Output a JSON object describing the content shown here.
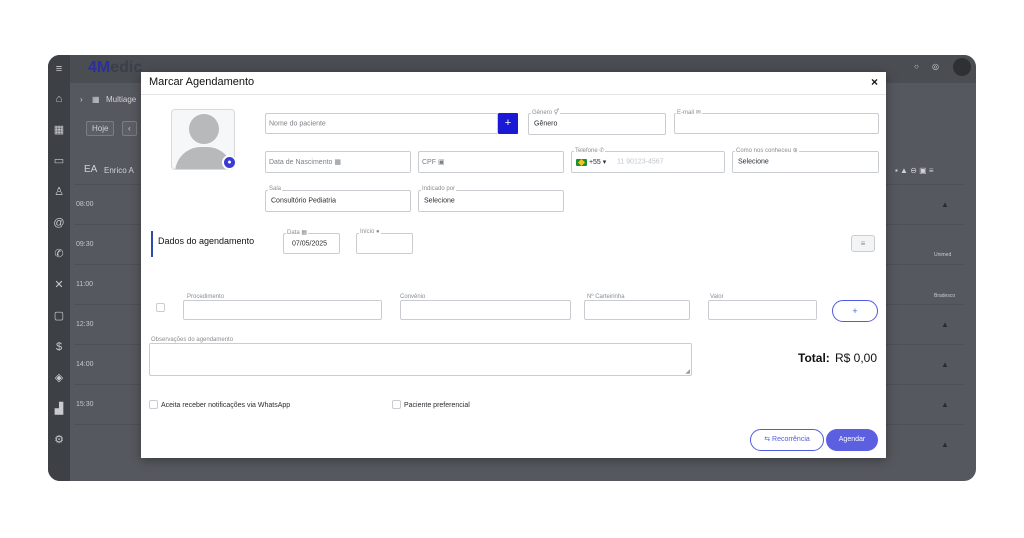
{
  "app": {
    "brand_prefix": "4M",
    "brand_suffix": "edic",
    "breadcrumb": "Multiage",
    "today_button": "Hoje",
    "prev_icon": "‹",
    "patient_initials": "EA",
    "patient_name_partial": "Enrico A",
    "times": [
      "08:00",
      "09:30",
      "11:00",
      "12:30",
      "14:00",
      "15:30"
    ],
    "row_notes": [
      "Unimed",
      "Bradesco"
    ],
    "colors": {
      "brand": "#2b2f9e",
      "accent": "#4f5be0",
      "primary_button": "#1a1ad6"
    }
  },
  "modal": {
    "title": "Marcar Agendamento",
    "close": "×",
    "patient_name": {
      "placeholder": "Nome do paciente",
      "add": "+"
    },
    "genero": {
      "label": "Gênero",
      "icon": "⚥",
      "value": "Gênero"
    },
    "email": {
      "label": "E-mail",
      "icon": "✉"
    },
    "birth": {
      "placeholder": "Data de Nascimento",
      "icon": "▦"
    },
    "cpf": {
      "placeholder": "CPF",
      "icon": "▣"
    },
    "telefone": {
      "label": "Telefone",
      "icon": "✆",
      "country_code": "+55",
      "caret": "▾",
      "placeholder": "11 90123-4567"
    },
    "conheceu": {
      "label": "Como nos conheceu",
      "icon": "⊕",
      "value": "Selecione"
    },
    "sala": {
      "label": "Sala",
      "value": "Consultório Pediatria"
    },
    "indicado": {
      "label": "Indicado por",
      "value": "Selecione"
    },
    "section_title": "Dados do agendamento",
    "data": {
      "label": "Data",
      "icon": "▦",
      "value": "07/05/2025"
    },
    "inicio": {
      "label": "Início",
      "icon": "●"
    },
    "list_icon": "≡",
    "procedimento": {
      "label": "Procedimento"
    },
    "convenio": {
      "label": "Convênio"
    },
    "carteirinha": {
      "label": "Nº Carteirinha"
    },
    "valor": {
      "label": "Valor"
    },
    "add_item": "+",
    "observacoes": {
      "label": "Observações do agendamento"
    },
    "total_label": "Total:",
    "total_value": "R$ 0,00",
    "whatsapp": "Aceita receber notificações via WhatsApp",
    "preferencial": "Paciente preferencial",
    "recorrencia_icon": "⇆",
    "recorrencia": "Recorrência",
    "agendar": "Agendar"
  }
}
